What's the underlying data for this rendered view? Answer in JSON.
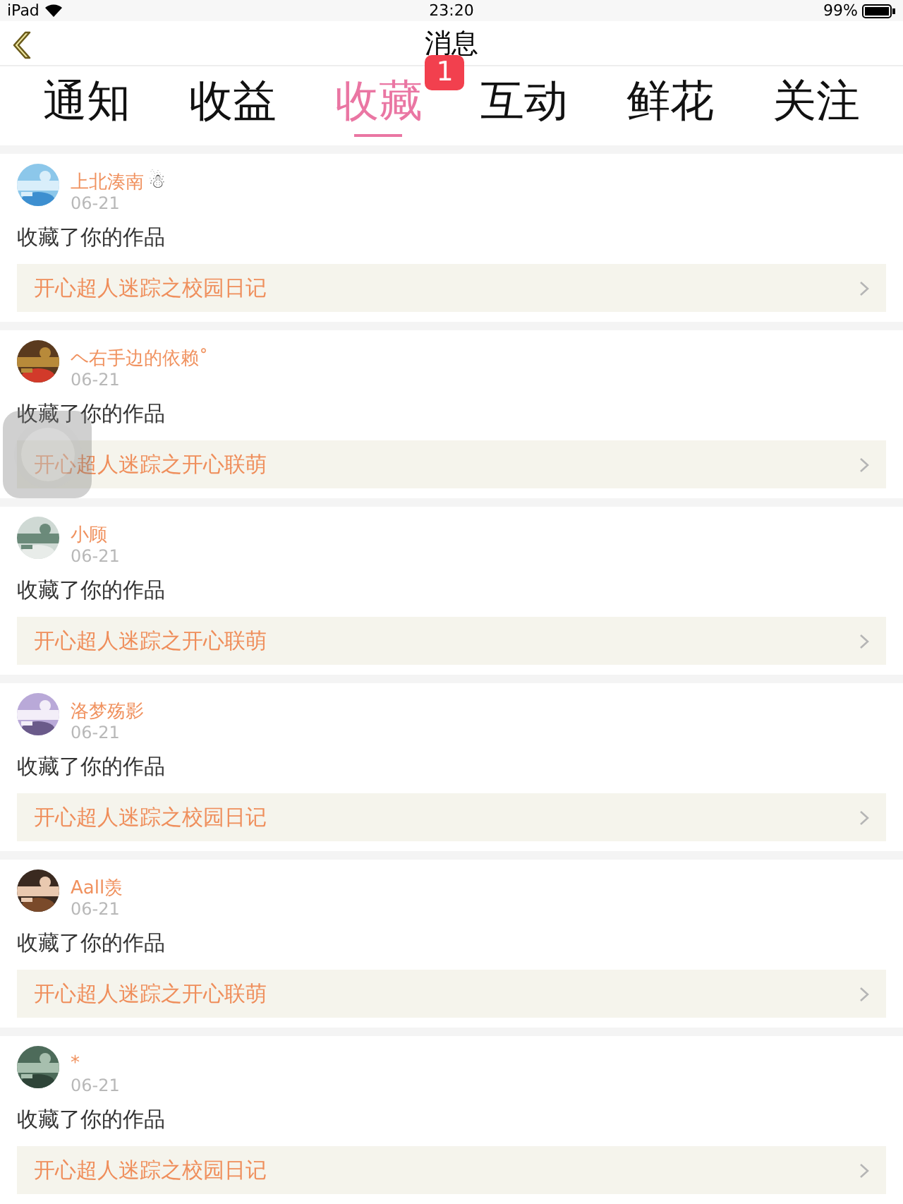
{
  "status_bar": {
    "device": "iPad",
    "time": "23:20",
    "battery": "99%"
  },
  "nav": {
    "title": "消息"
  },
  "tabs": [
    {
      "label": "通知",
      "selected": false
    },
    {
      "label": "收益",
      "selected": false
    },
    {
      "label": "收藏",
      "selected": true,
      "badge": "1"
    },
    {
      "label": "互动",
      "selected": false
    },
    {
      "label": "鲜花",
      "selected": false
    },
    {
      "label": "关注",
      "selected": false
    }
  ],
  "items": [
    {
      "name": "上北湊南",
      "emoji": "☃",
      "date": "06-21",
      "action": "收藏了你的作品",
      "work": "开心超人迷踪之校园日记"
    },
    {
      "name": "ヘ右手边的依赖˚",
      "date": "06-21",
      "action": "收藏了你的作品",
      "work": "开心超人迷踪之开心联萌"
    },
    {
      "name": "小顾",
      "date": "06-21",
      "action": "收藏了你的作品",
      "work": "开心超人迷踪之开心联萌"
    },
    {
      "name": "洛梦殇影",
      "date": "06-21",
      "action": "收藏了你的作品",
      "work": "开心超人迷踪之校园日记"
    },
    {
      "name": "Aall羡",
      "date": "06-21",
      "action": "收藏了你的作品",
      "work": "开心超人迷踪之开心联萌"
    },
    {
      "name": "*",
      "date": "06-21",
      "action": "收藏了你的作品",
      "work": "开心超人迷踪之校园日记"
    }
  ]
}
